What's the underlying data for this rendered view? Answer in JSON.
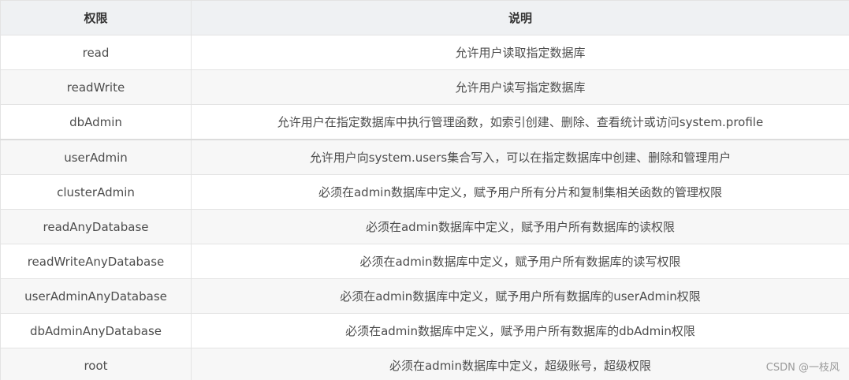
{
  "table": {
    "headers": [
      "权限",
      "说明"
    ],
    "rows": [
      {
        "permission": "read",
        "description": "允许用户读取指定数据库"
      },
      {
        "permission": "readWrite",
        "description": "允许用户读写指定数据库"
      },
      {
        "permission": "dbAdmin",
        "description": "允许用户在指定数据库中执行管理函数，如索引创建、删除、查看统计或访问system.profile"
      },
      {
        "permission": "userAdmin",
        "description": "允许用户向system.users集合写入，可以在指定数据库中创建、删除和管理用户"
      },
      {
        "permission": "clusterAdmin",
        "description": "必须在admin数据库中定义，赋予用户所有分片和复制集相关函数的管理权限"
      },
      {
        "permission": "readAnyDatabase",
        "description": "必须在admin数据库中定义，赋予用户所有数据库的读权限"
      },
      {
        "permission": "readWriteAnyDatabase",
        "description": "必须在admin数据库中定义，赋予用户所有数据库的读写权限"
      },
      {
        "permission": "userAdminAnyDatabase",
        "description": "必须在admin数据库中定义，赋予用户所有数据库的userAdmin权限"
      },
      {
        "permission": "dbAdminAnyDatabase",
        "description": "必须在admin数据库中定义，赋予用户所有数据库的dbAdmin权限"
      },
      {
        "permission": "root",
        "description": "必须在admin数据库中定义，超级账号，超级权限"
      }
    ]
  },
  "watermark": "CSDN @一枝风",
  "colors": {
    "header_bg": "#eff1f3",
    "stripe_bg": "#f7f7f7",
    "border": "#e3e3e3"
  }
}
